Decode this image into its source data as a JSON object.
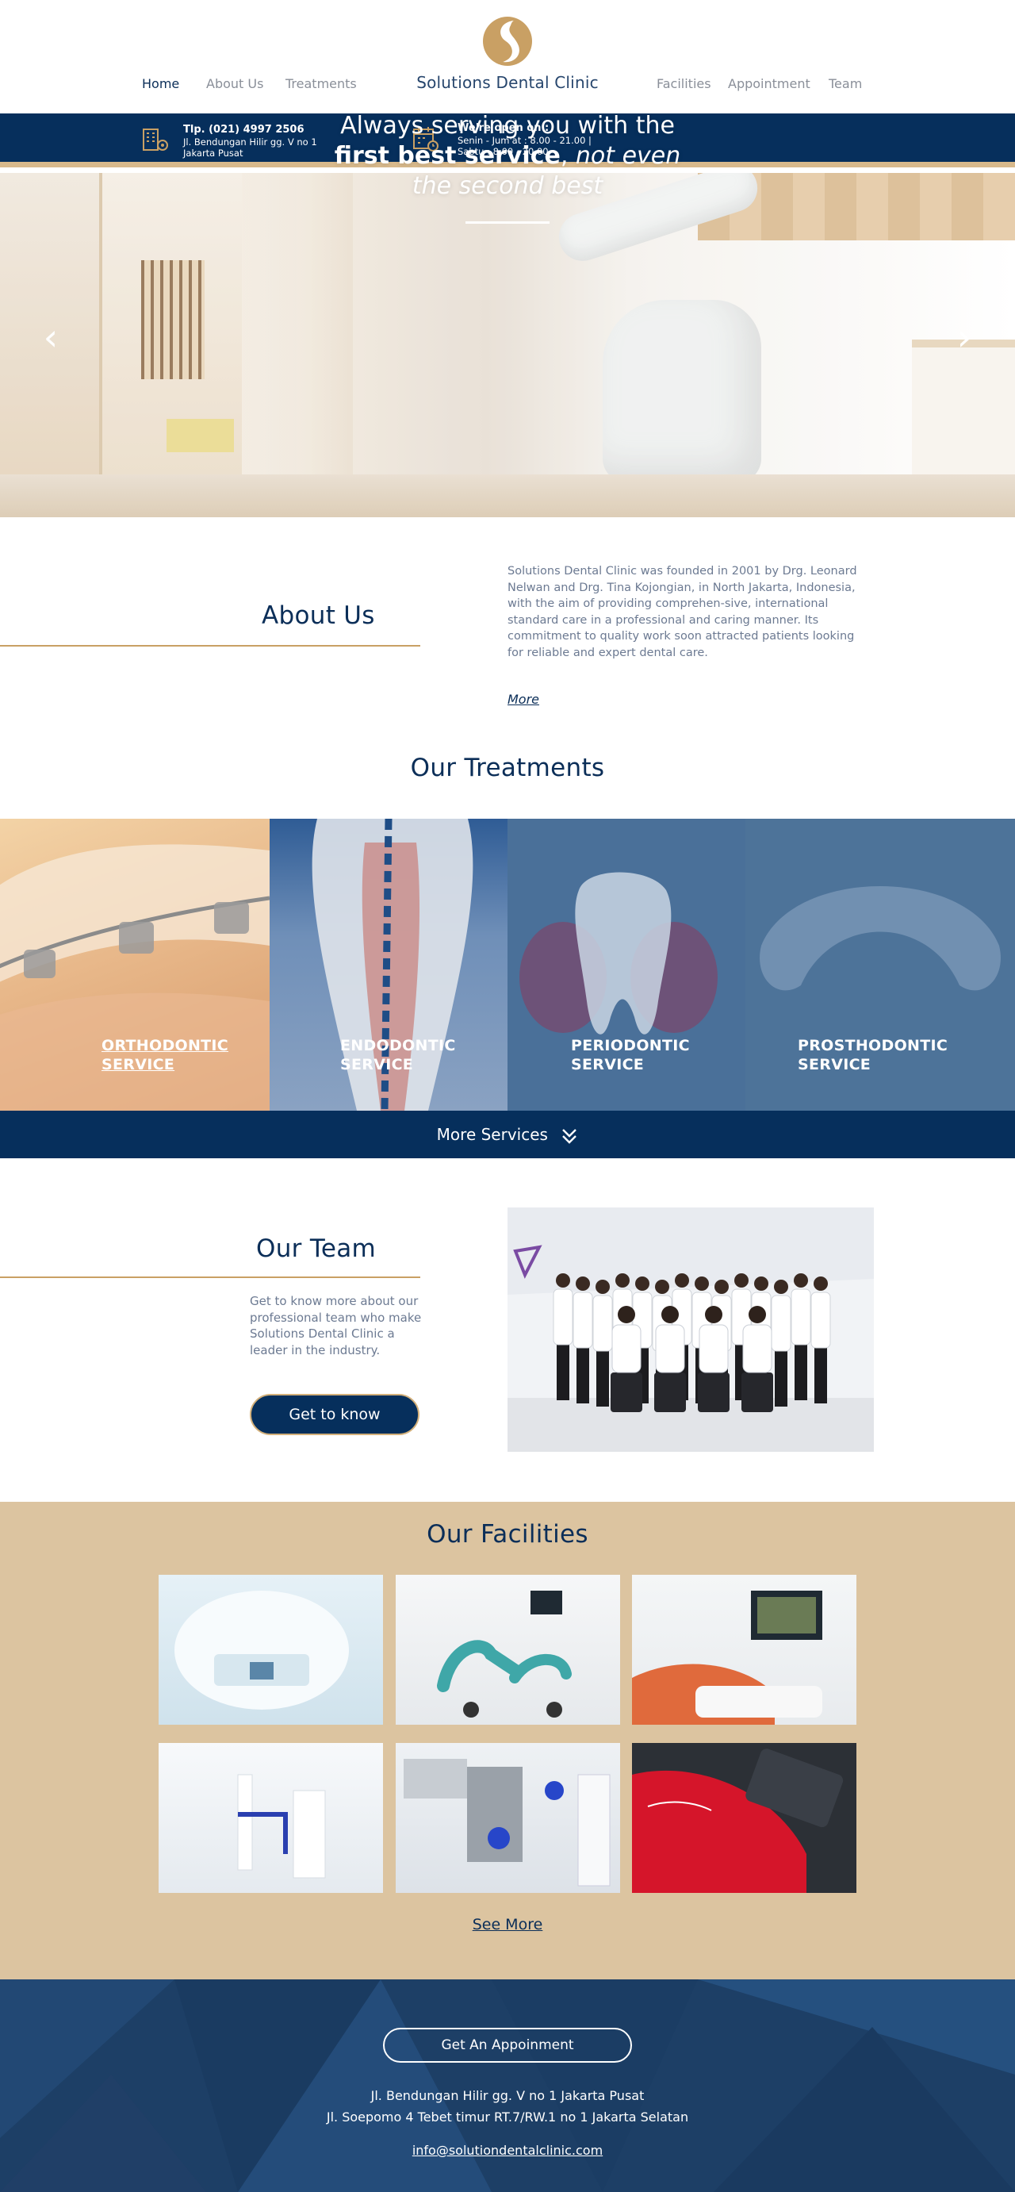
{
  "header": {
    "brand": "Solutions Dental Clinic",
    "nav_left": [
      "Home",
      "About Us",
      "Treatments"
    ],
    "nav_right": [
      "Facilities",
      "Appointment",
      "Team"
    ],
    "active": "Home"
  },
  "infobar": {
    "phone": "Tlp. (021) 4997 2506",
    "address_line1": "Jl. Bendungan Hilir gg. V no 1",
    "address_line2": "Jakarta Pusat",
    "hours_title": "We're open on :",
    "hours_line1": "Senin - Jum'at : 8.00 - 21.00 |",
    "hours_line2": "Sabtu : 8.00 - 20.00"
  },
  "hero": {
    "line1": "Always serving you with the",
    "bold": "first best service",
    "comma": ",",
    "italic1": " not even",
    "italic2": "the second best",
    "prev": "‹",
    "next": "›"
  },
  "about": {
    "title": "About Us",
    "body": "Solutions Dental Clinic was founded in 2001 by Drg. Leonard Nelwan and Drg. Tina Kojongian, in North Jakarta, Indonesia, with the aim of providing comprehen-sive, international standard care in a professional and caring manner. Its commitment to quality work soon attracted patients looking for reliable and expert dental care.",
    "more": "More"
  },
  "treatments": {
    "title": "Our Treatments",
    "items": [
      {
        "line1": "ORTHODONTIC",
        "line2": "SERVICE"
      },
      {
        "line1": "ENDODONTIC",
        "line2": "SERVICE"
      },
      {
        "line1": "PERIODONTIC",
        "line2": "SERVICE"
      },
      {
        "line1": "PROSTHODONTIC",
        "line2": "SERVICE"
      }
    ],
    "more": "More Services",
    "more_icon": "double-chevron-down-icon"
  },
  "team": {
    "title": "Our Team",
    "body": "Get to know more about our professional team who make Solutions Dental Clinic a leader in the industry.",
    "button": "Get to know"
  },
  "facilities": {
    "title": "Our Facilities",
    "see_more": "See More"
  },
  "footer": {
    "button": "Get An Appoinment",
    "address1": "Jl. Bendungan Hilir gg. V no 1 Jakarta Pusat",
    "address2": "Jl. Soepomo 4 Tebet timur RT.7/RW.1 no 1 Jakarta Selatan",
    "email": "info@solutiondentalclinic.com"
  },
  "colors": {
    "navy": "#062f5c",
    "gold": "#c9a064",
    "sand": "#dcc4a0",
    "footer": "#1d3f66"
  }
}
